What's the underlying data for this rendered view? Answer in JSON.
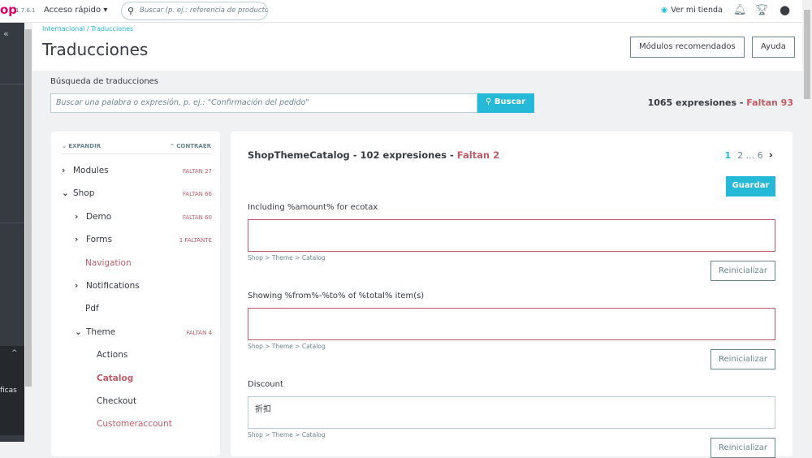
{
  "topbar": {
    "logo": "op",
    "version": "1.7.6.1",
    "quick_access": "Acceso rápido ▾",
    "search_placeholder": "Buscar (p. ej.: referencia de producto, nombre de cliente…)",
    "view_store": "Ver mi tienda"
  },
  "sidebar": {
    "collapse": "«",
    "partial_label": "ficas",
    "expand_up": "^"
  },
  "header": {
    "breadcrumb": "Internacional / Traducciones",
    "title": "Traducciones",
    "btn_modules": "Módulos recomendados",
    "btn_help": "Ayuda"
  },
  "search": {
    "label": "Búsqueda de traducciones",
    "placeholder": "Buscar una palabra o expresión, p. ej.: \"Confirmación del pedido\"",
    "button": "Buscar",
    "total": "1065 expresiones - ",
    "missing": "Faltan 93"
  },
  "tree": {
    "expand": "EXPANDIR",
    "collapse": "CONTRAER",
    "items": [
      {
        "label": "Modules",
        "chev": "›",
        "count": "FALTAN 27",
        "missing": false
      },
      {
        "label": "Shop",
        "chev": "⌄",
        "count": "FALTAN 66",
        "missing": false
      },
      {
        "label": "Demo",
        "chev": "›",
        "count": "FALTAN 60",
        "missing": false
      },
      {
        "label": "Forms",
        "chev": "›",
        "count": "1 FALTANTE",
        "missing": false
      },
      {
        "label": "Navigation",
        "chev": "",
        "count": "",
        "missing": true
      },
      {
        "label": "Notifications",
        "chev": "›",
        "count": "",
        "missing": false
      },
      {
        "label": "Pdf",
        "chev": "",
        "count": "",
        "missing": false
      },
      {
        "label": "Theme",
        "chev": "⌄",
        "count": "FALTAN 4",
        "missing": false
      },
      {
        "label": "Actions",
        "chev": "",
        "count": "",
        "missing": false
      },
      {
        "label": "Catalog",
        "chev": "",
        "count": "",
        "missing": true
      },
      {
        "label": "Checkout",
        "chev": "",
        "count": "",
        "missing": false
      },
      {
        "label": "Customeraccount",
        "chev": "",
        "count": "",
        "missing": true
      }
    ]
  },
  "panel": {
    "title": "ShopThemeCatalog - 102 expresiones - ",
    "missing": "Faltan 2",
    "pages": {
      "current": "1",
      "next": "2",
      "ellipsis": "... 6",
      "arrow": "›"
    },
    "save": "Guardar",
    "fields": [
      {
        "label": "Including %amount% for ecotax",
        "value": "",
        "path": "Shop > Theme > Catalog",
        "reset": "Reinicializar"
      },
      {
        "label": "Showing %from%-%to% of %total% item(s)",
        "value": "",
        "path": "Shop > Theme > Catalog",
        "reset": "Reinicializar"
      },
      {
        "label": "Discount",
        "value": "折扣",
        "path": "Shop > Theme > Catalog",
        "reset": "Reinicializar"
      }
    ]
  }
}
